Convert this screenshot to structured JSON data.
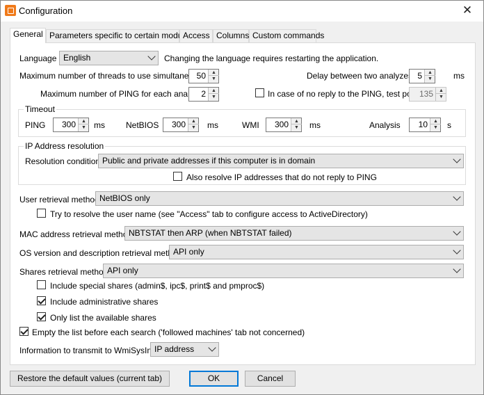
{
  "window": {
    "title": "Configuration",
    "close": "✕"
  },
  "tabs": [
    "General",
    "Parameters specific to certain modules",
    "Access",
    "Columns",
    "Custom commands"
  ],
  "general": {
    "language_label": "Language",
    "language_value": "English",
    "language_note": "Changing the language requires restarting the application.",
    "threads_label": "Maximum number of threads to use simultaneously",
    "threads_value": "50",
    "delay_label": "Delay between two analyzes",
    "delay_value": "5",
    "delay_unit": "ms",
    "ping_count_label": "Maximum number of PING for each analysis",
    "ping_count_value": "2",
    "noreply_label": "In case of no reply to the PING, test port",
    "noreply_checked": false,
    "port_value": "135"
  },
  "timeout": {
    "group_label": "Timeout",
    "ping_label": "PING",
    "ping_value": "300",
    "ping_unit": "ms",
    "netbios_label": "NetBIOS",
    "netbios_value": "300",
    "netbios_unit": "ms",
    "wmi_label": "WMI",
    "wmi_value": "300",
    "wmi_unit": "ms",
    "analysis_label": "Analysis",
    "analysis_value": "10",
    "analysis_unit": "s"
  },
  "ip_resolution": {
    "group_label": "IP Address resolution",
    "condition_label": "Resolution condition",
    "condition_value": "Public and private addresses if this computer is in domain",
    "also_resolve_label": "Also resolve IP addresses that do not reply to PING",
    "also_resolve_checked": false
  },
  "user": {
    "method_label": "User retrieval method",
    "method_value": "NetBIOS only",
    "resolve_label": "Try to resolve the user name (see \"Access\" tab to configure access to ActiveDirectory)",
    "resolve_checked": false
  },
  "mac": {
    "label": "MAC address retrieval method",
    "value": "NBTSTAT then ARP (when NBTSTAT failed)"
  },
  "os": {
    "label": "OS version and description retrieval method",
    "value": "API only"
  },
  "shares": {
    "label": "Shares retrieval method",
    "value": "API only",
    "special_label": "Include special shares (admin$, ipc$, print$ and pmproc$)",
    "special_checked": false,
    "admin_label": "Include administrative shares",
    "admin_checked": true,
    "available_label": "Only list the available shares",
    "available_checked": true
  },
  "empty_list": {
    "label": "Empty the list before each search ('followed machines' tab not concerned)",
    "checked": true
  },
  "wmisys": {
    "label": "Information to transmit to WmiSysInfos",
    "value": "IP address"
  },
  "buttons": {
    "restore": "Restore the default values (current tab)",
    "ok": "OK",
    "cancel": "Cancel"
  },
  "icons": {
    "up": "▲",
    "down": "▼"
  },
  "colors": {
    "accent": "#0078d7",
    "app_icon": "#f07a1a"
  }
}
